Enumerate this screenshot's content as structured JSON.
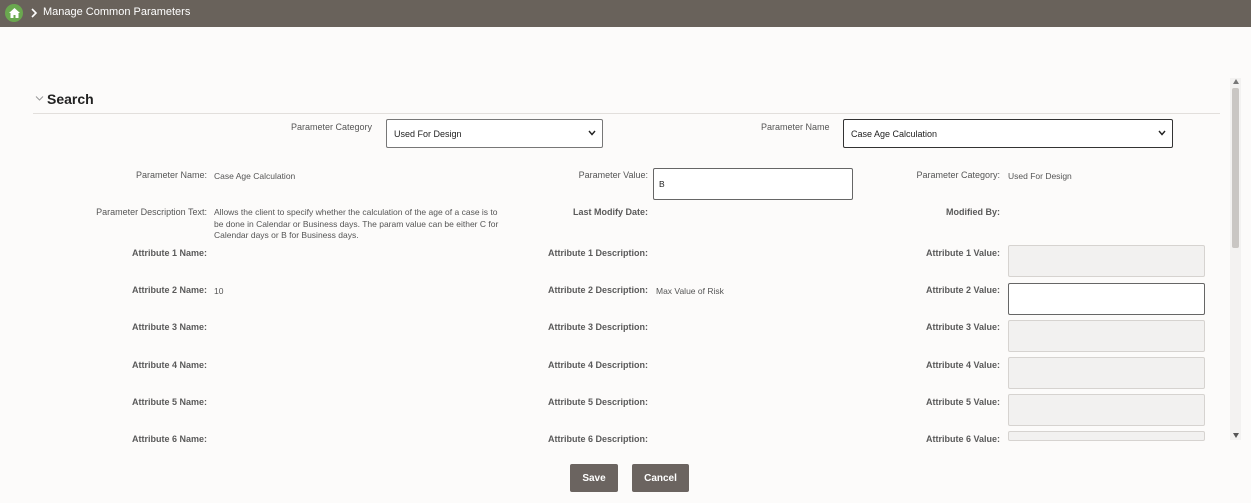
{
  "breadcrumb": {
    "title": "Manage Common Parameters"
  },
  "section": {
    "title": "Search"
  },
  "search": {
    "category_label": "Parameter Category",
    "category_value": "Used For Design",
    "name_label": "Parameter Name",
    "name_value": "Case Age Calculation"
  },
  "details": {
    "param_name_label": "Parameter Name:",
    "param_name_value": "Case Age Calculation",
    "param_value_label": "Parameter Value:",
    "param_value": "B",
    "param_category_label": "Parameter Category:",
    "param_category_value": "Used For Design",
    "desc_label": "Parameter Description Text:",
    "desc_value": "Allows the client to specify whether the calculation of the age of a case is to be done in Calendar or Business days. The param value can be either C for Calendar days or B for Business days.",
    "last_modify_label": "Last Modify Date:",
    "modified_by_label": "Modified By:"
  },
  "attributes": [
    {
      "name_label": "Attribute 1 Name:",
      "name_value": "",
      "desc_label": "Attribute 1 Description:",
      "desc_value": "",
      "value_label": "Attribute 1 Value:",
      "value": ""
    },
    {
      "name_label": "Attribute 2 Name:",
      "name_value": "10",
      "desc_label": "Attribute 2 Description:",
      "desc_value": "Max Value of Risk",
      "value_label": "Attribute 2 Value:",
      "value": ""
    },
    {
      "name_label": "Attribute 3 Name:",
      "name_value": "",
      "desc_label": "Attribute 3 Description:",
      "desc_value": "",
      "value_label": "Attribute 3 Value:",
      "value": ""
    },
    {
      "name_label": "Attribute 4 Name:",
      "name_value": "",
      "desc_label": "Attribute 4 Description:",
      "desc_value": "",
      "value_label": "Attribute 4 Value:",
      "value": ""
    },
    {
      "name_label": "Attribute 5 Name:",
      "name_value": "",
      "desc_label": "Attribute 5 Description:",
      "desc_value": "",
      "value_label": "Attribute 5 Value:",
      "value": ""
    },
    {
      "name_label": "Attribute 6 Name:",
      "name_value": "",
      "desc_label": "Attribute 6 Description:",
      "desc_value": "",
      "value_label": "Attribute 6 Value:",
      "value": ""
    }
  ],
  "buttons": {
    "save": "Save",
    "cancel": "Cancel"
  },
  "colors": {
    "header": "#69625b",
    "home": "#6aa84f",
    "button": "#6b6460"
  }
}
